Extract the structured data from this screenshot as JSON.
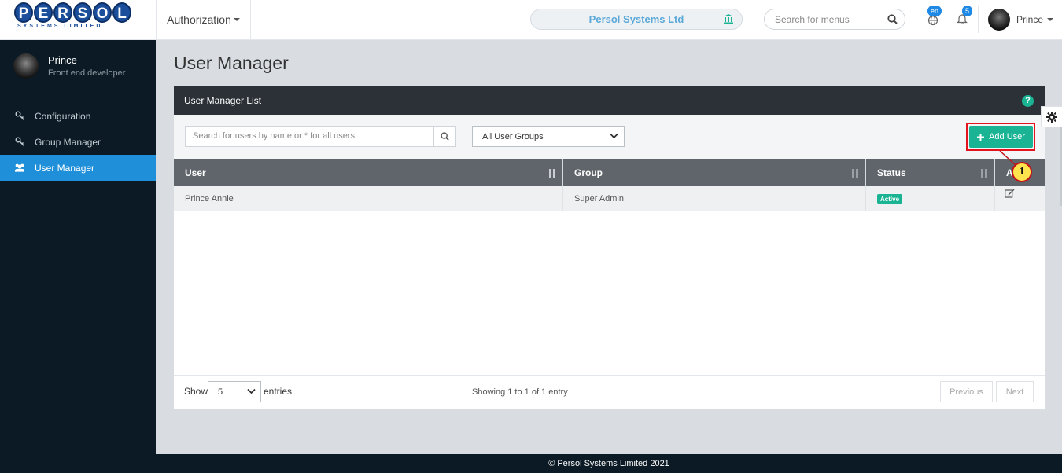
{
  "brand": {
    "logo_letters": [
      "P",
      "E",
      "R",
      "S",
      "O",
      "L"
    ],
    "logo_sub": "SYSTEMS LIMITED"
  },
  "topbar": {
    "auth_menu_label": "Authorization",
    "company_name": "Persol Systems Ltd",
    "menu_search_placeholder": "Search for menus",
    "language_badge": "en",
    "notification_count": "5",
    "user_name": "Prince"
  },
  "sidebar": {
    "profile_name": "Prince",
    "profile_role": "Front end developer",
    "items": [
      {
        "label": "Configuration",
        "icon": "key-icon",
        "active": false
      },
      {
        "label": "Group Manager",
        "icon": "key-icon",
        "active": false
      },
      {
        "label": "User Manager",
        "icon": "users-icon",
        "active": true
      }
    ]
  },
  "main": {
    "page_title": "User Manager",
    "card_title": "User Manager List",
    "help_glyph": "?",
    "user_search_placeholder": "Search for users by name or * for all users",
    "group_filter_value": "All User Groups",
    "add_user_label": "Add User",
    "callout_number": "1",
    "columns": [
      "User",
      "Group",
      "Status",
      "A"
    ],
    "rows": [
      {
        "user": "Prince Annie",
        "group": "Super Admin",
        "status": "Active"
      }
    ],
    "show_label": "Show",
    "entries_value": "5",
    "entries_label": "entries",
    "info_text": "Showing 1 to 1 of 1 entry",
    "previous_label": "Previous",
    "next_label": "Next"
  },
  "footer": {
    "copyright": "© Persol Systems Limited 2021"
  },
  "colors": {
    "accent": "#1ab394",
    "sidebar_bg": "#0b1a24",
    "active_nav": "#1e8fd8",
    "highlight_red": "#e3141b"
  }
}
